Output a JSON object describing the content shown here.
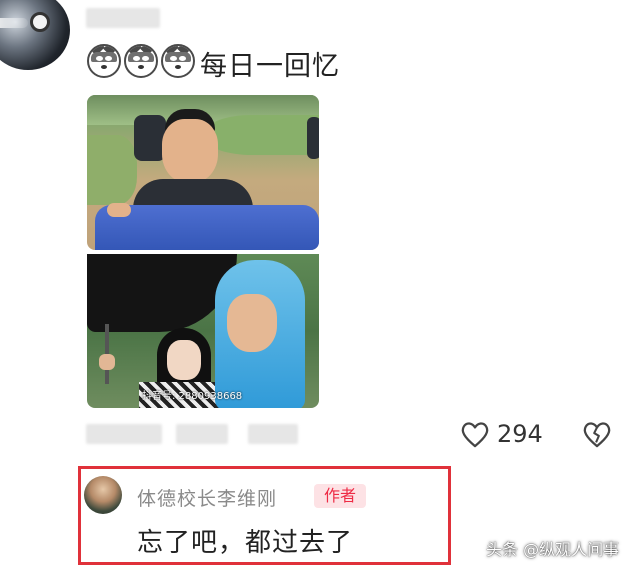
{
  "comment": {
    "emojis": [
      "husky-emoji",
      "husky-emoji",
      "husky-emoji"
    ],
    "text": "每日一回忆"
  },
  "image": {
    "watermark": "抖音号: 2880938668"
  },
  "actions": {
    "like_count": "294"
  },
  "reply": {
    "author_name": "体德校长李维刚",
    "author_badge": "作者",
    "text": "忘了吧，都过去了"
  },
  "source_watermark": "头条 @纵观人间事",
  "colors": {
    "highlight_border": "#e0313a",
    "badge_bg": "#fde2e5",
    "badge_text": "#ee2b45"
  }
}
